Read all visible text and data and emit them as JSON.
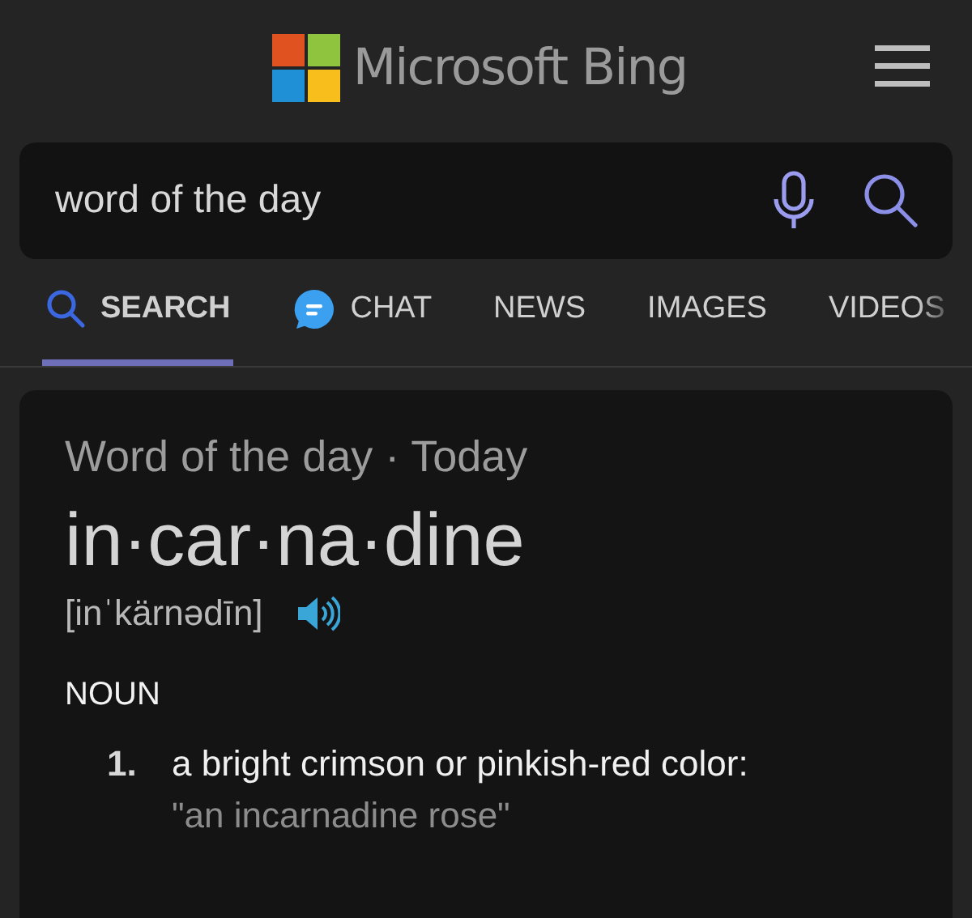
{
  "header": {
    "brand": "Microsoft Bing"
  },
  "search": {
    "value": "word of the day"
  },
  "tabs": [
    {
      "label": "SEARCH",
      "kind": "search",
      "selected": true
    },
    {
      "label": "CHAT",
      "kind": "chat",
      "selected": false
    },
    {
      "label": "NEWS",
      "kind": "plain",
      "selected": false
    },
    {
      "label": "IMAGES",
      "kind": "plain",
      "selected": false
    },
    {
      "label": "VIDEOS",
      "kind": "plain",
      "selected": false
    }
  ],
  "card": {
    "heading": "Word of the day · Today",
    "word": "in·car·na·dine",
    "pronunciation": "[inˈkärnədīn]",
    "part_of_speech": "NOUN",
    "definitions": [
      {
        "number": "1.",
        "text": "a bright crimson or pinkish-red color:",
        "example": "\"an incarnadine rose\""
      }
    ]
  }
}
